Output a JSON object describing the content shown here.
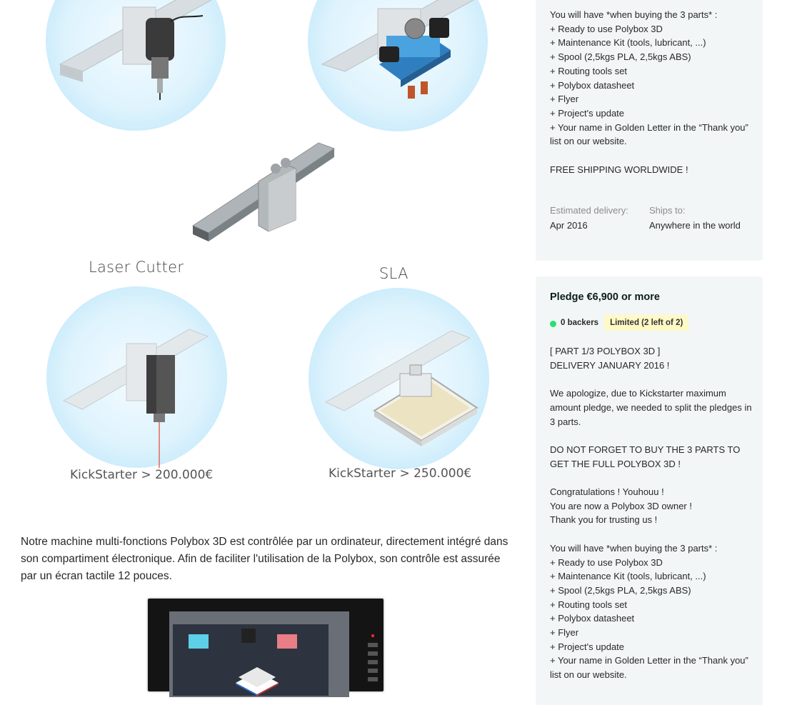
{
  "tools": {
    "laser_title": "Laser Cutter",
    "sla_title": "SLA",
    "laser_kickstarter_goal": "KickStarter >  200.000€",
    "sla_kickstarter_goal": "KickStarter >  250.000€"
  },
  "description": "Notre machine multi-fonctions Polybox 3D est contrôlée par un ordinateur, directement intégré dans son compartiment électronique. Afin de faciliter l'utilisation de la Polybox, son contrôle est assurée par un écran tactile 12 pouces.",
  "reward_top": {
    "contents": "You will have *when buying the 3 parts* :\n+ Ready to use Polybox 3D\n+ Maintenance Kit (tools, lubricant, ...)\n+ Spool (2,5kgs PLA, 2,5kgs ABS)\n+ Routing tools set\n+ Polybox datasheet\n+ Flyer\n+ Project's update\n+ Your name in Golden Letter in the “Thank you” list on our website.\n\nFREE SHIPPING WORLDWIDE !",
    "estimated_delivery_label": "Estimated delivery:",
    "estimated_delivery_value": "Apr 2016",
    "ships_to_label": "Ships to:",
    "ships_to_value": "Anywhere in the world"
  },
  "reward_second": {
    "pledge_title": "Pledge €6,900 or more",
    "backers": "0 backers",
    "limited": "Limited (2 left of 2)",
    "description": "[ PART 1/3 POLYBOX 3D ]\nDELIVERY JANUARY 2016 !\n\nWe apologize, due to Kickstarter maximum amount pledge, we needed to split the pledges in 3 parts.\n\nDO NOT FORGET TO BUY THE 3 PARTS TO GET THE FULL POLYBOX 3D !\n\nCongratulations ! Youhouu !\nYou are now a Polybox 3D owner !\nThank you for trusting us !\n\nYou will have *when buying the 3 parts* :\n+ Ready to use Polybox 3D\n+ Maintenance Kit (tools, lubricant, ...)\n+ Spool (2,5kgs PLA, 2,5kgs ABS)\n+ Routing tools set\n+ Polybox datasheet\n+ Flyer\n+ Project's update\n+ Your name in Golden Letter in the “Thank you” list on our website."
  },
  "colors": {
    "card_bg": "#f3f6f7",
    "limited_bg": "#fff9c6",
    "backer_dot": "#2bde73",
    "circle_blue": "#bfe7fa"
  }
}
